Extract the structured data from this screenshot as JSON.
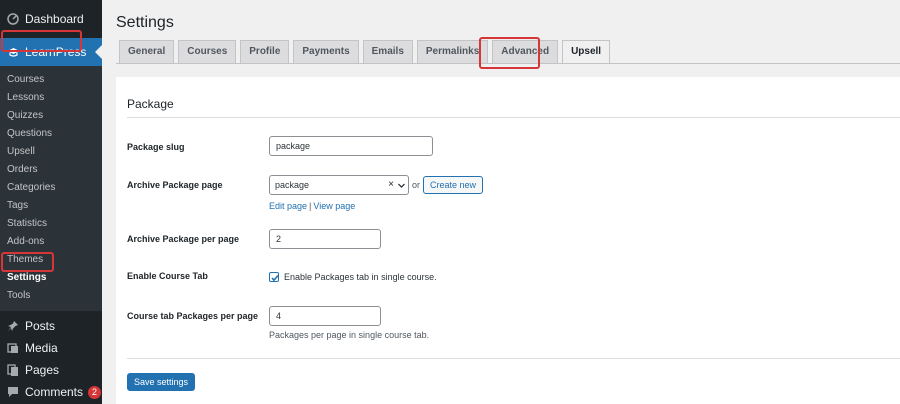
{
  "sidebar": {
    "dashboard": "Dashboard",
    "learnpress": "LearnPress",
    "submenu": [
      "Courses",
      "Lessons",
      "Quizzes",
      "Questions",
      "Upsell",
      "Orders",
      "Categories",
      "Tags",
      "Statistics",
      "Add-ons",
      "Themes",
      "Settings",
      "Tools"
    ],
    "posts": "Posts",
    "media": "Media",
    "pages": "Pages",
    "comments": "Comments",
    "comments_count": "2"
  },
  "page": {
    "title": "Settings"
  },
  "tabs": [
    "General",
    "Courses",
    "Profile",
    "Payments",
    "Emails",
    "Permalinks",
    "Advanced",
    "Upsell"
  ],
  "section": {
    "title": "Package"
  },
  "fields": {
    "slug": {
      "label": "Package slug",
      "value": "package"
    },
    "archive": {
      "label": "Archive Package page",
      "value": "package",
      "or": "or",
      "create": "Create new",
      "edit": "Edit page",
      "view": "View page",
      "sep": "|"
    },
    "per_page": {
      "label": "Archive Package per page",
      "value": "2"
    },
    "enable_tab": {
      "label": "Enable Course Tab",
      "text": "Enable Packages tab in single course."
    },
    "tab_per_page": {
      "label": "Course tab Packages per page",
      "value": "4",
      "help": "Packages per page in single course tab."
    }
  },
  "save_label": "Save settings",
  "colors": {
    "accent": "#2271b1",
    "highlight": "#d63638",
    "sidebar": "#1d2327"
  }
}
